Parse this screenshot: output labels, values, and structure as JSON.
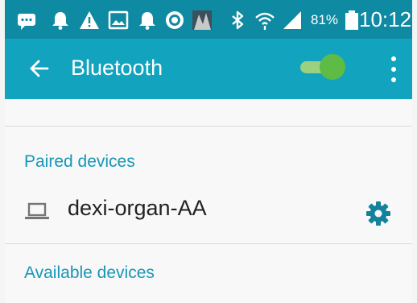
{
  "status_bar": {
    "battery_percent": "81%",
    "time": "10:12",
    "icons": [
      "message-icon",
      "notification-bell-icon",
      "alert-icon",
      "image-icon",
      "notification-bell-icon",
      "circle-app-icon",
      "photo-thumbnail-icon",
      "bluetooth-icon",
      "wifi-icon",
      "signal-icon",
      "battery-icon"
    ]
  },
  "app_bar": {
    "title": "Bluetooth",
    "back_icon": "arrow-left-icon",
    "menu_icon": "more-vert-icon",
    "bluetooth_enabled": true
  },
  "paired": {
    "header": "Paired devices",
    "devices": [
      {
        "name": "dexi-organ-AA",
        "icon": "laptop-icon",
        "action_icon": "gear-icon"
      }
    ]
  },
  "available": {
    "header": "Available devices"
  },
  "colors": {
    "status_bar": "#0f8aa3",
    "app_bar": "#12a3bf",
    "accent_text": "#1597b6",
    "switch_on": "#5dbb46"
  }
}
